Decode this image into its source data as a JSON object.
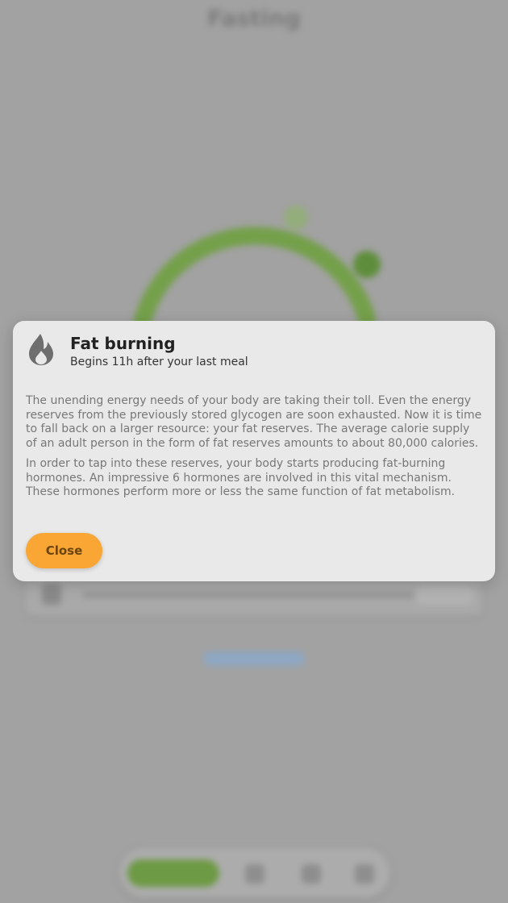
{
  "background": {
    "page_title": "Fasting"
  },
  "modal": {
    "icon": "flame-icon",
    "title": "Fat burning",
    "subtitle": "Begins 11h after your last meal",
    "paragraphs": [
      "The unending energy needs of your body are taking their toll. Even the energy reserves from the previously stored glycogen are soon exhausted. Now it is time to fall back on a larger resource: your fat reserves. The average calorie supply of an adult person in the form of fat reserves amounts to about 80,000 calories.",
      "In order to tap into these reserves, your body starts producing fat-burning hormones. An impressive 6 hormones are involved in this vital mechanism. These hormones perform more or less the same function of fat metabolism."
    ],
    "close_label": "Close"
  },
  "colors": {
    "accent": "#f9a634",
    "progress_green": "#6d9a44",
    "modal_bg": "#e9e9e9"
  }
}
